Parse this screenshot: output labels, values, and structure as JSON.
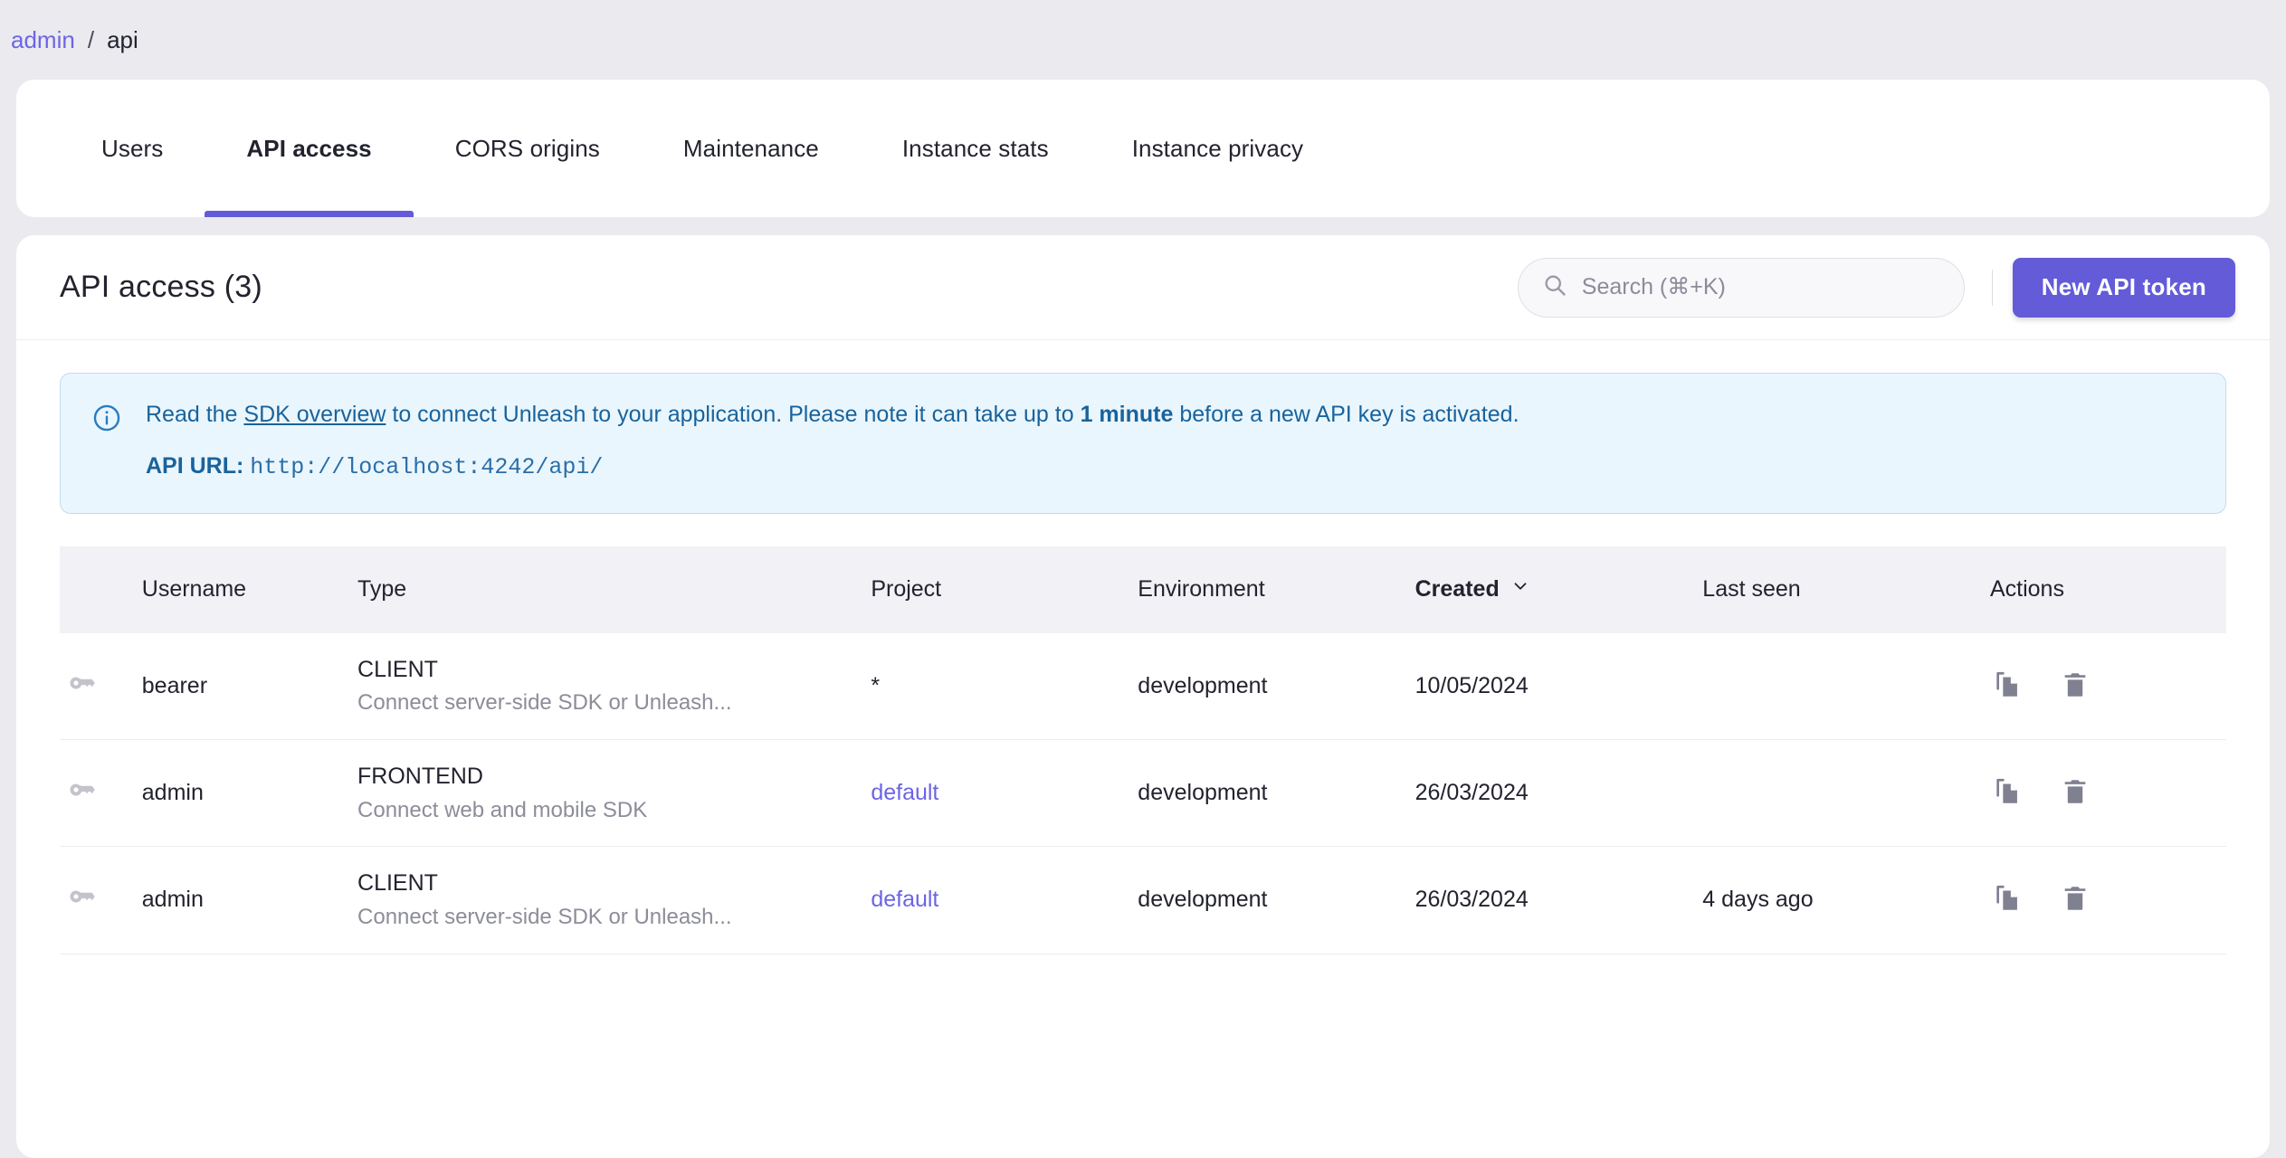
{
  "breadcrumb": {
    "root": "admin",
    "separator": "/",
    "current": "api"
  },
  "tabs": [
    {
      "label": "Users",
      "active": false
    },
    {
      "label": "API access",
      "active": true
    },
    {
      "label": "CORS origins",
      "active": false
    },
    {
      "label": "Maintenance",
      "active": false
    },
    {
      "label": "Instance stats",
      "active": false
    },
    {
      "label": "Instance privacy",
      "active": false
    }
  ],
  "header": {
    "title": "API access (3)",
    "search_placeholder": "Search (⌘+K)",
    "search_value": "",
    "new_token_label": "New API token"
  },
  "banner": {
    "text_before_link": "Read the ",
    "link_label": "SDK overview",
    "text_after_link": " to connect Unleash to your application. Please note it can take up to ",
    "bold_part": "1 minute",
    "text_end": " before a new API key is activated.",
    "api_url_label": "API URL",
    "api_url_separator": ": ",
    "api_url_value": "http://localhost:4242/api/"
  },
  "table": {
    "columns": {
      "username": "Username",
      "type": "Type",
      "project": "Project",
      "environment": "Environment",
      "created": "Created",
      "last_seen": "Last seen",
      "actions": "Actions"
    },
    "sorted_by": "Created",
    "sort_direction": "desc",
    "rows": [
      {
        "username": "bearer",
        "type": "CLIENT",
        "type_description": "Connect server-side SDK or Unleash...",
        "project": "*",
        "project_is_link": false,
        "environment": "development",
        "created": "10/05/2024",
        "last_seen": ""
      },
      {
        "username": "admin",
        "type": "FRONTEND",
        "type_description": "Connect web and mobile SDK",
        "project": "default",
        "project_is_link": true,
        "environment": "development",
        "created": "26/03/2024",
        "last_seen": ""
      },
      {
        "username": "admin",
        "type": "CLIENT",
        "type_description": "Connect server-side SDK or Unleash...",
        "project": "default",
        "project_is_link": true,
        "environment": "development",
        "created": "26/03/2024",
        "last_seen": "4 days ago"
      }
    ]
  },
  "colors": {
    "accent": "#635bd8",
    "link": "#6c65e5",
    "page_bg": "#eaeaef",
    "banner_bg": "#eaf6fd",
    "banner_border": "#bfdcf2",
    "banner_text": "#19639c",
    "table_header_bg": "#f1f1f6",
    "muted_text": "#8c8d99",
    "icon_gray": "#8b8c9a"
  },
  "icons": {
    "search": "search-icon",
    "info": "info-circle-icon",
    "key": "key-icon",
    "copy": "copy-icon",
    "delete": "trash-icon",
    "sort": "chevron-down-icon"
  }
}
